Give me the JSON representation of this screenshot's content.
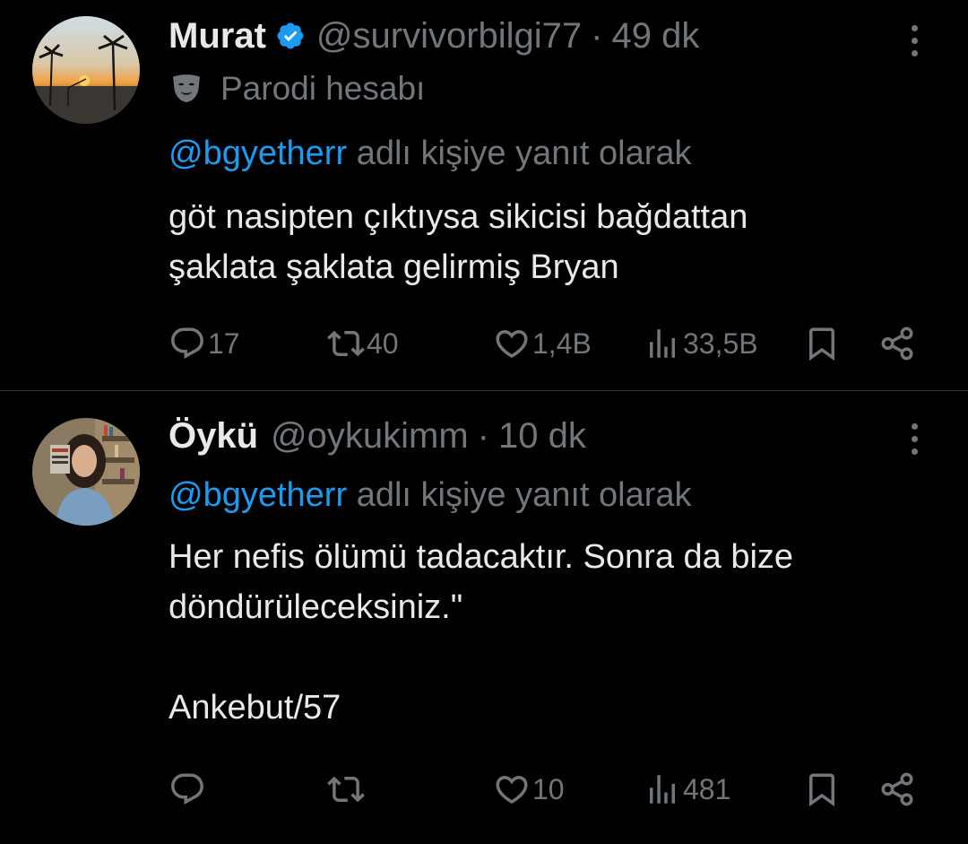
{
  "tweets": [
    {
      "display_name": "Murat",
      "verified": true,
      "handle": "@survivorbilgi77",
      "separator": "·",
      "time": "49 dk",
      "parody_label": "Parodi hesabı",
      "reply_mention": "@bgyetherr",
      "reply_suffix": "adlı kişiye yanıt olarak",
      "text_lines": [
        "göt nasipten çıktıysa sikicisi bağdattan",
        "şaklata şaklata gelirmiş Bryan"
      ],
      "stats": {
        "replies": "17",
        "reposts": "40",
        "likes": "1,4B",
        "views": "33,5B"
      }
    },
    {
      "display_name": "Öykü",
      "verified": false,
      "handle": "@oykukimm",
      "separator": "·",
      "time": "10 dk",
      "reply_mention": "@bgyetherr",
      "reply_suffix": "adlı kişiye yanıt olarak",
      "text_lines": [
        "Her nefis ölümü tadacaktır. Sonra da bize",
        "döndürüleceksiniz.\"",
        "",
        "Ankebut/57"
      ],
      "stats": {
        "replies": "",
        "reposts": "",
        "likes": "10",
        "views": "481"
      }
    }
  ],
  "colors": {
    "background": "#000000",
    "text_primary": "#e7e9ea",
    "text_secondary": "#71767b",
    "accent": "#1d9bf0",
    "divider": "#2f3336"
  },
  "icons": {
    "reply": "reply-icon",
    "repost": "repost-icon",
    "like": "like-icon",
    "views": "views-icon",
    "bookmark": "bookmark-icon",
    "share": "share-icon",
    "more": "more-icon",
    "verified": "verified-badge-icon",
    "parody": "parody-mask-icon"
  }
}
